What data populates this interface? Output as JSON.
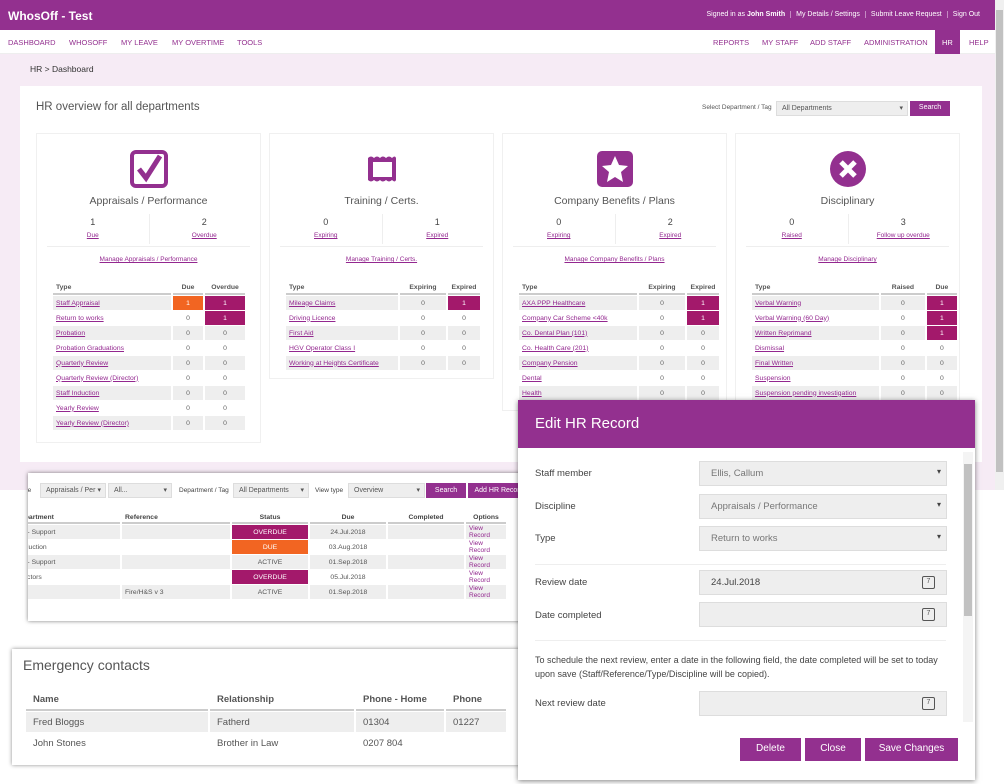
{
  "app": {
    "title": "WhosOff - Test",
    "signed_in_prefix": "Signed in as",
    "user": "John Smith",
    "links": [
      "My Details / Settings",
      "Submit Leave Request",
      "Sign Out"
    ]
  },
  "nav": {
    "left": [
      "DASHBOARD",
      "WHOSOFF",
      "MY LEAVE",
      "MY OVERTIME",
      "TOOLS"
    ],
    "right": [
      "REPORTS",
      "MY STAFF",
      "ADD STAFF",
      "ADMINISTRATION",
      "HR",
      "HELP"
    ],
    "active": "HR"
  },
  "breadcrumb": "HR > Dashboard",
  "overview": {
    "title": "HR overview for all departments",
    "select_label": "Select Department / Tag",
    "select_value": "All Departments",
    "search": "Search"
  },
  "colors": {
    "accent": "#93308f",
    "overdue": "#a3196b",
    "due": "#f26522"
  },
  "cards": [
    {
      "icon": "checkbox-icon",
      "name": "Appraisals / Performance",
      "a": "1",
      "a_label": "Due",
      "b": "2",
      "b_label": "Overdue",
      "manage": "Manage Appraisals / Performance",
      "cols": [
        "Type",
        "Due",
        "Overdue"
      ],
      "rows": [
        [
          "Staff Appraisal",
          "1",
          "1"
        ],
        [
          "Return to works",
          "0",
          "1"
        ],
        [
          "Probation",
          "0",
          "0"
        ],
        [
          "Probation Graduations",
          "0",
          "0"
        ],
        [
          "Quarterly Review",
          "0",
          "0"
        ],
        [
          "Quarterly Review (Director)",
          "0",
          "0"
        ],
        [
          "Staff Induction",
          "0",
          "0"
        ],
        [
          "Yearly Review",
          "0",
          "0"
        ],
        [
          "Yearly Review (Director)",
          "0",
          "0"
        ]
      ]
    },
    {
      "icon": "certificate-frame-icon",
      "name": "Training / Certs.",
      "a": "0",
      "a_label": "Expiring",
      "b": "1",
      "b_label": "Expired",
      "manage": "Manage Training / Certs.",
      "cols": [
        "Type",
        "Expiring",
        "Expired"
      ],
      "rows": [
        [
          "Mileage Claims",
          "0",
          "1"
        ],
        [
          "Driving Licence",
          "0",
          "0"
        ],
        [
          "First Aid",
          "0",
          "0"
        ],
        [
          "HGV Operator Class I",
          "0",
          "0"
        ],
        [
          "Working at Heights Certificate",
          "0",
          "0"
        ]
      ]
    },
    {
      "icon": "star-icon",
      "name": "Company Benefits / Plans",
      "a": "0",
      "a_label": "Expiring",
      "b": "2",
      "b_label": "Expired",
      "manage": "Manage Company Benefits / Plans",
      "cols": [
        "Type",
        "Expiring",
        "Expired"
      ],
      "rows": [
        [
          "AXA PPP Healthcare",
          "0",
          "1"
        ],
        [
          "Company Car Scheme <40k",
          "0",
          "1"
        ],
        [
          "Co. Dental Plan (101)",
          "0",
          "0"
        ],
        [
          "Co. Health Care (201)",
          "0",
          "0"
        ],
        [
          "Company Pension",
          "0",
          "0"
        ],
        [
          "Dental",
          "0",
          "0"
        ],
        [
          "Health",
          "0",
          "0"
        ]
      ]
    },
    {
      "icon": "x-circle-icon",
      "name": "Disciplinary",
      "a": "0",
      "a_label": "Raised",
      "b": "3",
      "b_label": "Follow up overdue",
      "manage": "Manage Disciplinary",
      "cols": [
        "Type",
        "Raised",
        "Due"
      ],
      "rows": [
        [
          "Verbal Warning",
          "0",
          "1"
        ],
        [
          "Verbal Warning (60 Day)",
          "0",
          "1"
        ],
        [
          "Written Reprimand",
          "0",
          "1"
        ],
        [
          "Dismissal",
          "0",
          "0"
        ],
        [
          "Final Written",
          "0",
          "0"
        ],
        [
          "Suspension",
          "0",
          "0"
        ],
        [
          "Suspension pending investigation",
          "0",
          "0"
        ]
      ]
    }
  ],
  "records": {
    "type_partial": "pe",
    "discipline": "Appraisals / Per",
    "type": "All...",
    "dept_label": "Department / Tag",
    "dept": "All Departments",
    "view_label": "View type",
    "view": "Overview",
    "search": "Search",
    "add": "Add HR Record",
    "cols": [
      "epartment",
      "Reference",
      "Status",
      "Due",
      "Completed",
      "Options"
    ],
    "rows": [
      [
        "K - Support",
        "",
        "OVERDUE",
        "24.Jul.2018",
        "",
        "View Record"
      ],
      [
        "oduction",
        "",
        "DUE",
        "03.Aug.2018",
        "",
        "View Record"
      ],
      [
        "K - Support",
        "",
        "ACTIVE",
        "01.Sep.2018",
        "",
        "View Record"
      ],
      [
        "rectors",
        "",
        "OVERDUE",
        "05.Jul.2018",
        "",
        "View Record"
      ],
      [
        "",
        "Fire/H&S v 3",
        "ACTIVE",
        "01.Sep.2018",
        "",
        "View Record"
      ]
    ]
  },
  "emergency": {
    "title": "Emergency contacts",
    "cols": [
      "Name",
      "Relationship",
      "Phone - Home",
      "Phone"
    ],
    "rows": [
      [
        "Fred Bloggs",
        "Fatherd",
        "01304",
        "01227"
      ],
      [
        "John Stones",
        "Brother in Law",
        "0207 804",
        ""
      ]
    ]
  },
  "modal": {
    "title": "Edit HR Record",
    "staff_label": "Staff member",
    "staff": "Ellis, Callum",
    "discipline_label": "Discipline",
    "discipline": "Appraisals / Performance",
    "type_label": "Type",
    "type": "Return to works",
    "review_label": "Review date",
    "review": "24.Jul.2018",
    "completed_label": "Date completed",
    "completed": "",
    "note": "To schedule the next review, enter a date in the following field, the date completed will be set to today upon save (Staff/Reference/Type/Discipline will be copied).",
    "next_label": "Next review date",
    "next": "",
    "cal_day": "7",
    "delete": "Delete",
    "close": "Close",
    "save": "Save Changes"
  }
}
